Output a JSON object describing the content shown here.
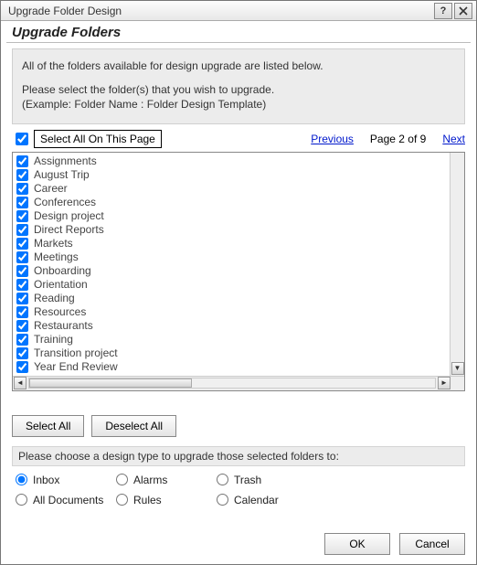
{
  "title": "Upgrade Folder Design",
  "section_title": "Upgrade Folders",
  "info_line1": "All of the folders available for design upgrade are listed below.",
  "info_line2": "Please select the folder(s) that you wish to upgrade.",
  "info_line3": "(Example: Folder Name : Folder Design Template)",
  "select_all_page": "Select All On This Page",
  "pager": {
    "prev": "Previous",
    "status": "Page 2 of 9",
    "next": "Next"
  },
  "folders": [
    "Assignments",
    "August Trip",
    "Career",
    "Conferences",
    "Design project",
    "Direct Reports",
    "Markets",
    "Meetings",
    "Onboarding",
    "Orientation",
    "Reading",
    "Resources",
    "Restaurants",
    "Training",
    "Transition project",
    "Year End Review"
  ],
  "buttons": {
    "select_all": "Select All",
    "deselect_all": "Deselect All",
    "ok": "OK",
    "cancel": "Cancel"
  },
  "design_prompt": "Please choose a design type to upgrade those selected folders to:",
  "designs": [
    {
      "label": "Inbox",
      "checked": true
    },
    {
      "label": "Alarms",
      "checked": false
    },
    {
      "label": "Trash",
      "checked": false
    },
    {
      "label": "All Documents",
      "checked": false
    },
    {
      "label": "Rules",
      "checked": false
    },
    {
      "label": "Calendar",
      "checked": false
    }
  ]
}
